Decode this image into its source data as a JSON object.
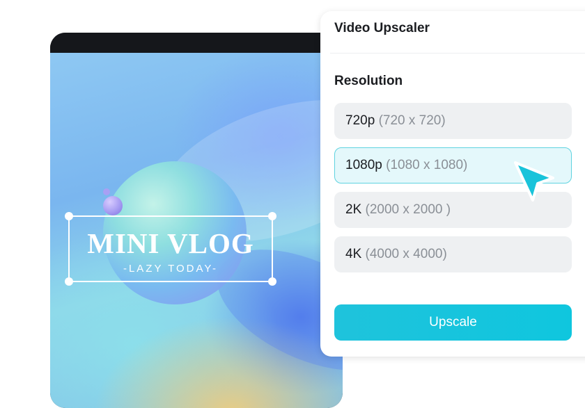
{
  "preview": {
    "title": "MINI VLOG",
    "subtitle": "-LAZY TODAY-"
  },
  "panel": {
    "title": "Video Upscaler",
    "section_label": "Resolution",
    "options": [
      {
        "name": "720p",
        "size": "(720 x 720)"
      },
      {
        "name": "1080p",
        "size": "(1080 x 1080)",
        "selected": true
      },
      {
        "name": "2K",
        "size": "(2000 x 2000 )"
      },
      {
        "name": "4K",
        "size": "(4000 x 4000)"
      }
    ],
    "button_label": "Upscale"
  },
  "colors": {
    "accent": "#1fc3dc",
    "selected_bg": "#e4f8fb",
    "option_bg": "#eef0f2"
  },
  "icons": {
    "cursor": "pointer-arrow-icon"
  }
}
